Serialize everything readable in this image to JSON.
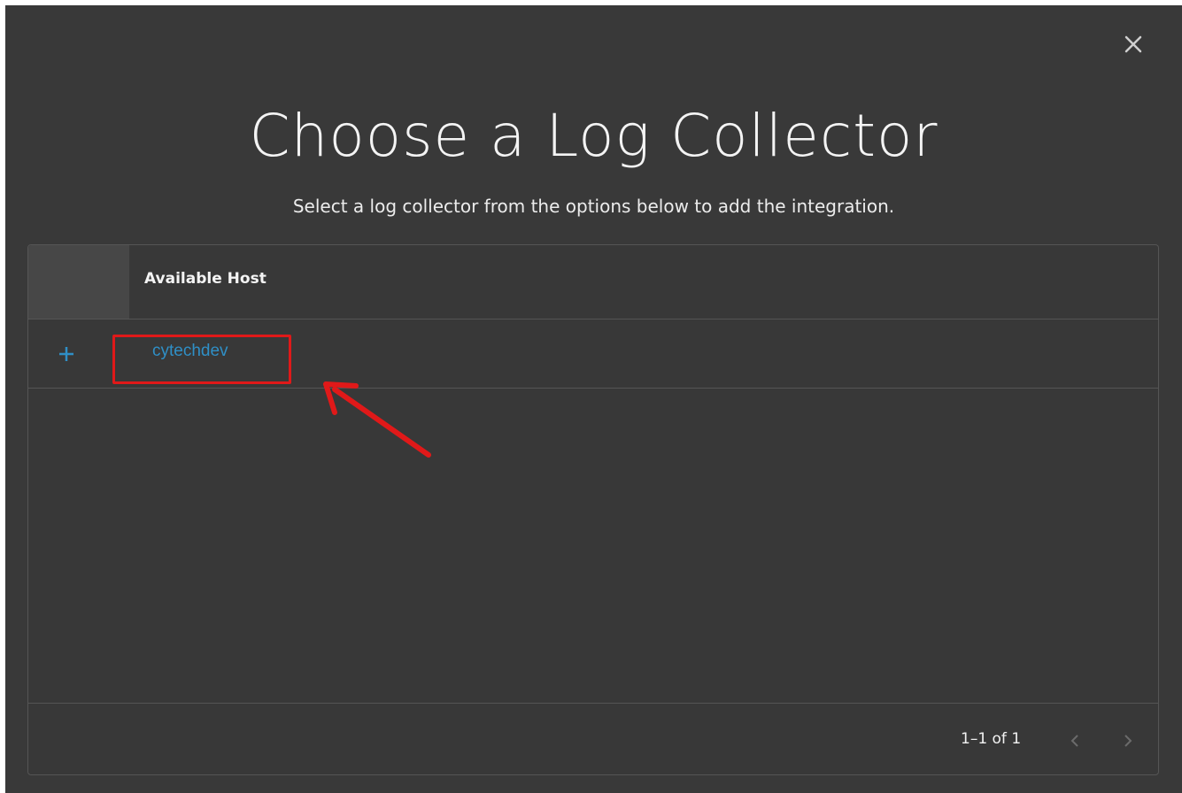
{
  "dialog": {
    "title": "Choose a Log Collector",
    "subtitle": "Select a log collector from the options below to add the integration.",
    "close_icon": "close-icon"
  },
  "table": {
    "columns": [
      "",
      "Available Host"
    ],
    "rows": [
      {
        "action_icon": "plus-icon",
        "host": "cytechdev"
      }
    ]
  },
  "pagination": {
    "range": "1–1 of 1",
    "prev_icon": "chevron-left-icon",
    "next_icon": "chevron-right-icon"
  },
  "colors": {
    "background": "#393939",
    "header_cell": "#474747",
    "accent": "#2f8fc6",
    "annotation": "#e01919"
  }
}
